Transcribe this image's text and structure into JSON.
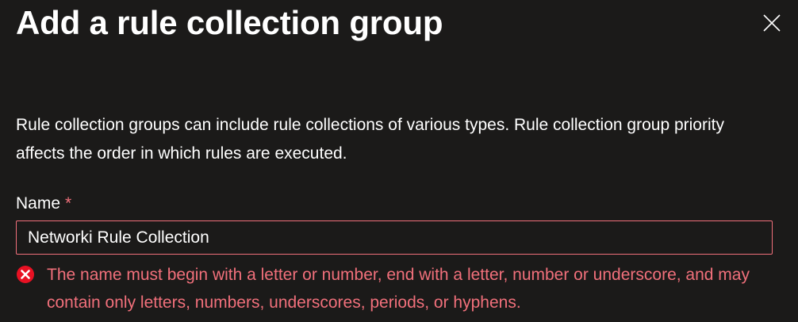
{
  "panel": {
    "title": "Add a rule collection group",
    "close_icon": "close-icon",
    "description": "Rule collection groups can include rule collections of various types. Rule collection group priority affects the order in which rules are executed."
  },
  "name_field": {
    "label": "Name",
    "required_marker": "*",
    "value": "Networki Rule Collection",
    "error_icon": "error-circle-icon",
    "error_message": "The name must begin with a letter or number, end with a letter, number or underscore, and may contain only letters, numbers, underscores, periods, or hyphens."
  },
  "colors": {
    "background": "#1b1a19",
    "text": "#ffffff",
    "error": "#f1707b",
    "error_icon_fill": "#e81123"
  }
}
